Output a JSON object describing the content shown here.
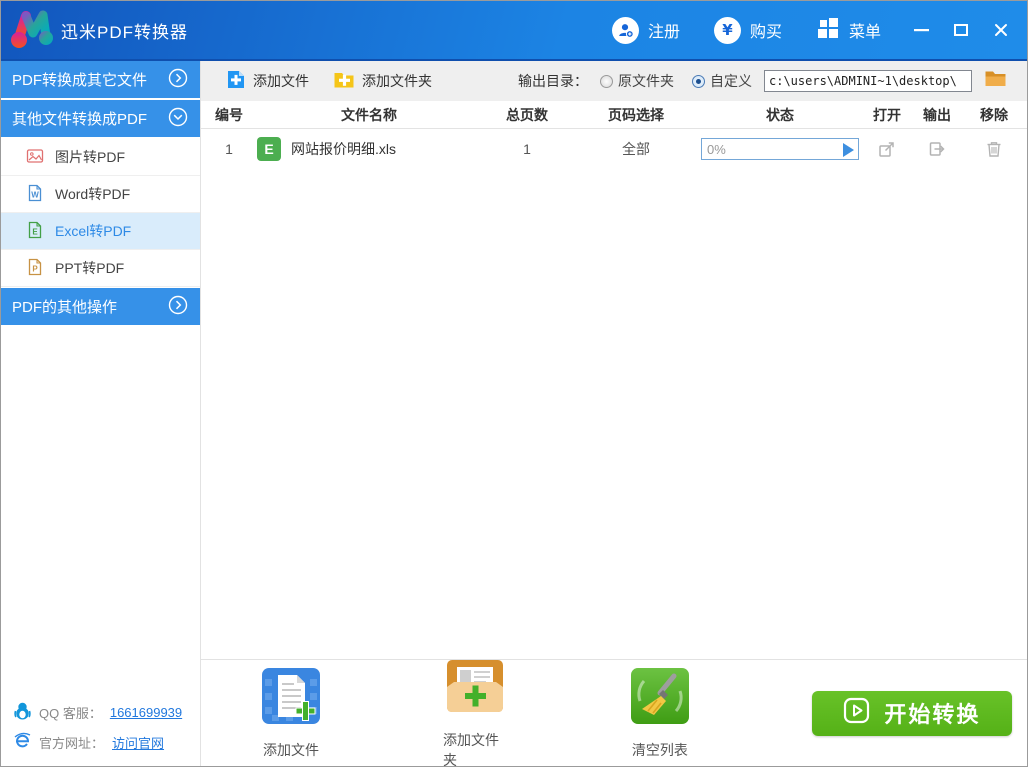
{
  "window": {
    "title": "迅米PDF转换器",
    "actions": [
      {
        "label": "注册",
        "icon": "register-user-icon"
      },
      {
        "label": "购买",
        "icon": "buy-yuan-icon",
        "symbol": "¥"
      },
      {
        "label": "菜单",
        "icon": "menu-grid-icon"
      }
    ]
  },
  "sidebar": {
    "groups": [
      {
        "label": "PDF转换成其它文件",
        "state": "collapsed"
      },
      {
        "label": "其他文件转换成PDF",
        "state": "expanded",
        "items": [
          {
            "label": "图片转PDF",
            "icon": "image-icon"
          },
          {
            "label": "Word转PDF",
            "icon": "word-doc-icon",
            "letter": "W"
          },
          {
            "label": "Excel转PDF",
            "icon": "excel-doc-icon",
            "letter": "E",
            "selected": true
          },
          {
            "label": "PPT转PDF",
            "icon": "ppt-doc-icon",
            "letter": "P"
          }
        ]
      },
      {
        "label": "PDF的其他操作",
        "state": "collapsed"
      }
    ],
    "footer": {
      "qq_label": "QQ 客服：",
      "qq_number": "1661699939",
      "site_label": "官方网址：",
      "site_link": "访问官网"
    }
  },
  "toolbar": {
    "add_file_label": "添加文件",
    "add_folder_label": "添加文件夹",
    "output_dir_label": "输出目录：",
    "radio_original_label": "原文件夹",
    "radio_custom_label": "自定义",
    "custom_selected": true,
    "path_value": "c:\\users\\ADMINI~1\\desktop\\"
  },
  "table": {
    "headers": [
      "编号",
      "文件名称",
      "总页数",
      "页码选择",
      "状态",
      "打开",
      "输出",
      "移除"
    ],
    "rows": [
      {
        "no": "1",
        "badge_letter": "E",
        "file_name": "网站报价明细.xls",
        "total_pages": "1",
        "page_range": "全部",
        "progress": "0%"
      }
    ]
  },
  "footer": {
    "add_file_label": "添加文件",
    "add_folder_label": "添加文件夹",
    "clear_list_label": "清空列表",
    "start_label": "开始转换"
  },
  "colors": {
    "titlebar_gradient_start": "#1256bd",
    "titlebar_gradient_end": "#1f8ce9",
    "sidebar_header_blue": "#3691e8",
    "selected_item_bg": "#d9ecfb",
    "selected_item_text": "#2e8ae6",
    "excel_badge_green": "#4cae50",
    "start_button_green": "#55b117",
    "link_blue": "#2278dd",
    "progress_border": "#74a7d8",
    "toolbar_bg": "#efefef"
  }
}
